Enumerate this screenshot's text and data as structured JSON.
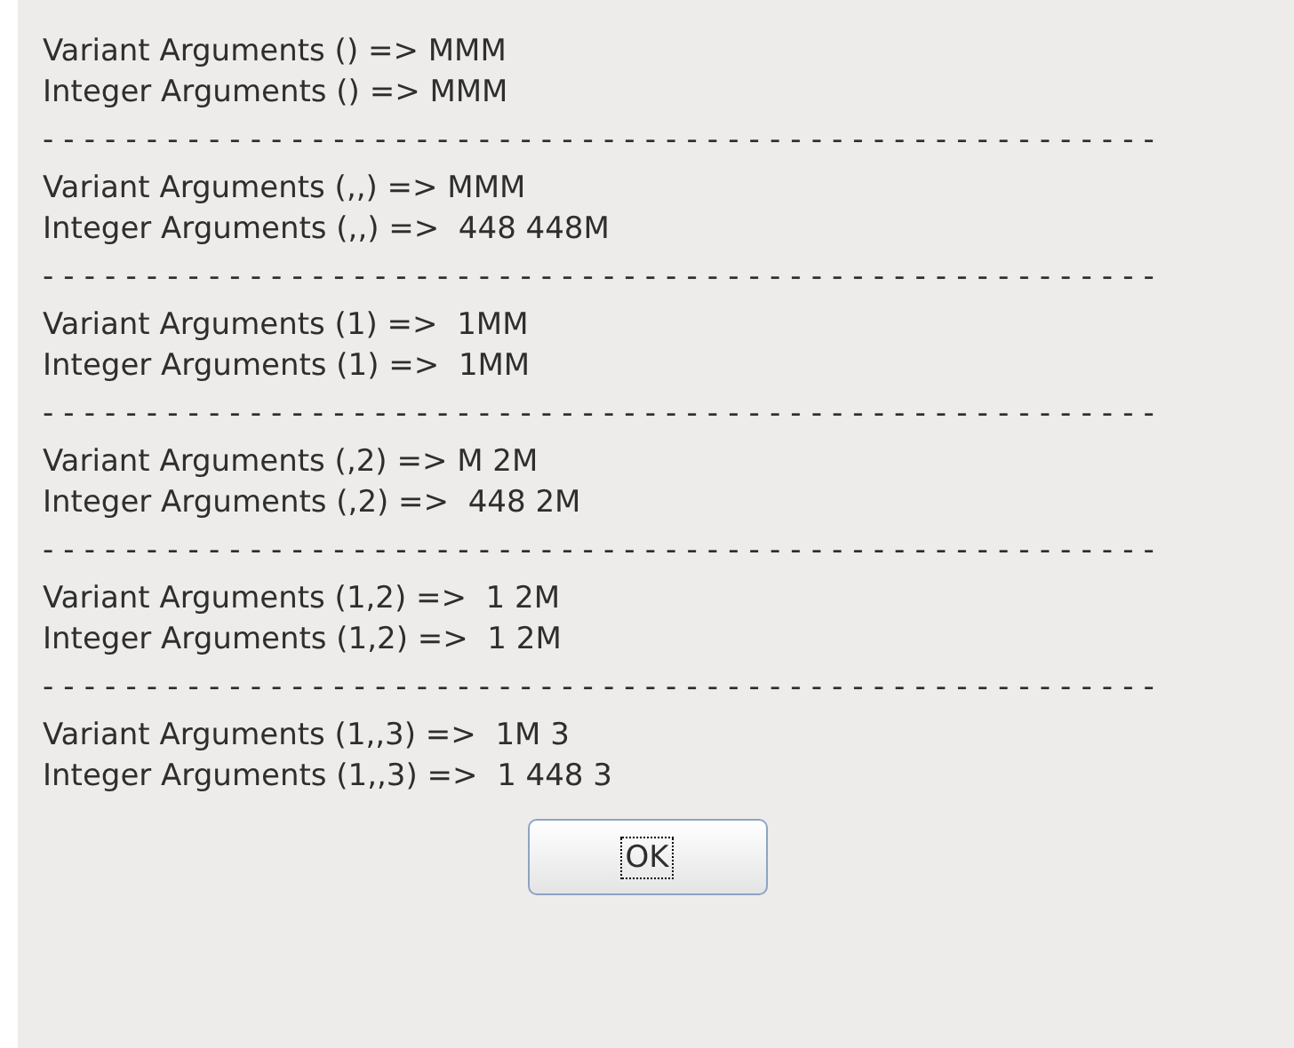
{
  "lines": [
    {
      "kind": "text",
      "text": "Variant Arguments () => MMM"
    },
    {
      "kind": "text",
      "text": "Integer Arguments () => MMM"
    },
    {
      "kind": "separator",
      "text": "------------------------------------------------------"
    },
    {
      "kind": "text",
      "text": "Variant Arguments (,,) => MMM"
    },
    {
      "kind": "text",
      "text": "Integer Arguments (,,) =>  448 448M"
    },
    {
      "kind": "separator",
      "text": "------------------------------------------------------"
    },
    {
      "kind": "text",
      "text": "Variant Arguments (1) =>  1MM"
    },
    {
      "kind": "text",
      "text": "Integer Arguments (1) =>  1MM"
    },
    {
      "kind": "separator",
      "text": "------------------------------------------------------"
    },
    {
      "kind": "text",
      "text": "Variant Arguments (,2) => M 2M"
    },
    {
      "kind": "text",
      "text": "Integer Arguments (,2) =>  448 2M"
    },
    {
      "kind": "separator",
      "text": "------------------------------------------------------"
    },
    {
      "kind": "text",
      "text": "Variant Arguments (1,2) =>  1 2M"
    },
    {
      "kind": "text",
      "text": "Integer Arguments (1,2) =>  1 2M"
    },
    {
      "kind": "separator",
      "text": "------------------------------------------------------"
    },
    {
      "kind": "text",
      "text": "Variant Arguments (1,,3) =>  1M 3"
    },
    {
      "kind": "text",
      "text": "Integer Arguments (1,,3) =>  1 448 3"
    }
  ],
  "button": {
    "label": "OK",
    "focused": true
  }
}
